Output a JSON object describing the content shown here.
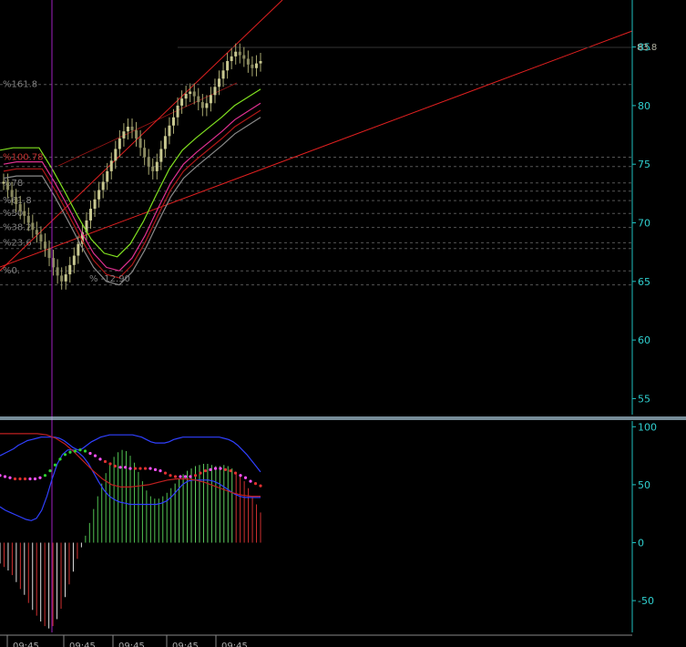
{
  "chart_data": [
    {
      "type": "candlestick",
      "panel": "price",
      "y_axis": {
        "ticks": [
          "85",
          "80",
          "75",
          "70",
          "65",
          "60",
          "55"
        ],
        "tick_values": [
          85,
          80,
          75,
          70,
          65,
          60,
          55
        ],
        "range": [
          54.8,
          87.3
        ]
      },
      "last_price_label": "83.8",
      "last_price": 83.8,
      "close_series": [
        73.5,
        72.8,
        72.2,
        71.6,
        71.0,
        70.6,
        70.0,
        69.4,
        69.0,
        68.4,
        67.8,
        67.0,
        66.2,
        65.5,
        65.0,
        65.6,
        66.4,
        67.2,
        68.2,
        69.2,
        70.2,
        71.2,
        72.0,
        72.8,
        73.5,
        74.4,
        75.3,
        76.3,
        77.2,
        77.8,
        78.2,
        77.9,
        77.2,
        76.4,
        75.6,
        74.8,
        74.4,
        75.2,
        76.3,
        77.4,
        78.3,
        79.0,
        80.0,
        80.6,
        81.0,
        81.2,
        80.8,
        80.3,
        79.8,
        80.2,
        80.9,
        81.6,
        82.3,
        83.0,
        83.8,
        84.2,
        84.6,
        84.3,
        84.0,
        83.5,
        83.2,
        83.6,
        83.8
      ],
      "fibonacci_labels": [
        "%161.8",
        "%100.78",
        "%78",
        "%61.8",
        "%50.",
        "%38.2",
        "%23.6",
        "%0."
      ],
      "fibonacci_levels": [
        81.8,
        75.6,
        73.4,
        71.9,
        70.8,
        69.6,
        68.3,
        65.9
      ],
      "extra_levels": [
        74.8,
        72.7,
        67.8
      ],
      "retracement_label": "% -12.90",
      "retracement_level": 64.7,
      "time_labels": [
        "09:45",
        "09:45",
        "09:45",
        "09:45",
        "09:45"
      ]
    },
    {
      "type": "bar",
      "panel": "oscillator",
      "y_axis": {
        "ticks": [
          "100",
          "50",
          "0",
          "-50"
        ],
        "tick_values": [
          100,
          50,
          0,
          -50
        ],
        "range": [
          -79,
          101
        ]
      },
      "histogram": [
        -18,
        -21,
        -24,
        -28,
        -34,
        -40,
        -45,
        -52,
        -58,
        -63,
        -68,
        -72,
        -74,
        -72,
        -66,
        -57,
        -47,
        -36,
        -25,
        -14,
        -4,
        6,
        17,
        29,
        40,
        51,
        60,
        68,
        74,
        78,
        80,
        79,
        75,
        69,
        61,
        53,
        45,
        40,
        38,
        38,
        40,
        43,
        47,
        51,
        55,
        59,
        62,
        64,
        66,
        67,
        68,
        68,
        67,
        66,
        66,
        67,
        66,
        64,
        61,
        57,
        53,
        47,
        40,
        33,
        26
      ],
      "upper_band": [
        75,
        77,
        79,
        81,
        84,
        86,
        88,
        89,
        90,
        91,
        91,
        91,
        91,
        90,
        88,
        85,
        82,
        80,
        81,
        84,
        87,
        89,
        91,
        92,
        93,
        93,
        93,
        93,
        93,
        93,
        92,
        91,
        89,
        87,
        86,
        86,
        86,
        87,
        89,
        90,
        91,
        91,
        91,
        91,
        91,
        91,
        91,
        91,
        91,
        90,
        89,
        87,
        84,
        80,
        76,
        71,
        66,
        61
      ],
      "lower_band": [
        31,
        28,
        26,
        24,
        22,
        20,
        19,
        21,
        28,
        40,
        55,
        68,
        76,
        80,
        80,
        78,
        74,
        68,
        60,
        52,
        45,
        40,
        37,
        35,
        34,
        33,
        33,
        33,
        33,
        33,
        33,
        34,
        36,
        40,
        45,
        50,
        53,
        54,
        54,
        54,
        54,
        53,
        51,
        48,
        45,
        42,
        40,
        39,
        39,
        39,
        39
      ],
      "dot_series": [
        58,
        57,
        56,
        55,
        55,
        55,
        55,
        55,
        56,
        58,
        62,
        67,
        72,
        76,
        78,
        79,
        80,
        79,
        77,
        75,
        72,
        70,
        68,
        66,
        65,
        65,
        64,
        64,
        64,
        64,
        64,
        63,
        62,
        60,
        58,
        57,
        57,
        57,
        57,
        58,
        60,
        62,
        63,
        64,
        64,
        63,
        62,
        60,
        58,
        56,
        53,
        51,
        49
      ],
      "red_line": [
        94,
        94,
        94,
        94,
        94,
        93,
        90,
        85,
        78,
        70,
        62,
        55,
        50,
        48,
        48,
        49,
        50,
        52,
        54,
        55,
        55,
        54,
        52,
        49,
        46,
        43,
        41,
        40,
        40
      ]
    }
  ]
}
